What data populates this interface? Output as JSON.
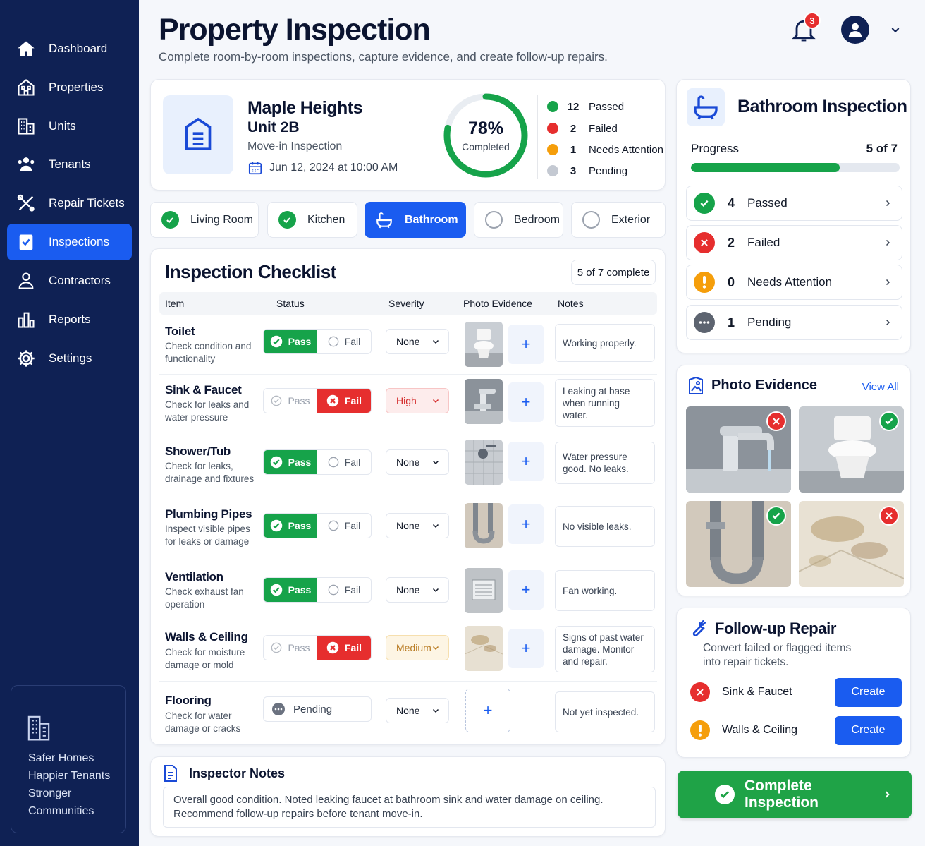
{
  "sidebar": {
    "items": [
      {
        "label": "Dashboard",
        "icon": "home-icon"
      },
      {
        "label": "Properties",
        "icon": "building-icon"
      },
      {
        "label": "Units",
        "icon": "units-icon"
      },
      {
        "label": "Tenants",
        "icon": "tenants-icon"
      },
      {
        "label": "Repair Tickets",
        "icon": "tools-icon"
      },
      {
        "label": "Inspections",
        "icon": "clipboard-check-icon",
        "active": true
      },
      {
        "label": "Contractors",
        "icon": "contractor-icon"
      },
      {
        "label": "Reports",
        "icon": "chart-icon"
      },
      {
        "label": "Settings",
        "icon": "gear-icon"
      }
    ],
    "promo": [
      "Safer Homes",
      "Happier Tenants",
      "Stronger",
      "Communities"
    ]
  },
  "header": {
    "title": "Property Inspection",
    "subtitle": "Complete room-by-room inspections, capture evidence, and create follow-up repairs.",
    "notification_count": "3"
  },
  "property": {
    "name": "Maple Heights",
    "unit": "Unit 2B",
    "type": "Move-in Inspection",
    "date": "Jun 12, 2024 at 10:00 AM",
    "completion_pct": 78,
    "completion_text": "78%",
    "completion_label": "Completed",
    "stats": [
      {
        "count": "12",
        "label": "Passed",
        "color": "#16a34a"
      },
      {
        "count": "2",
        "label": "Failed",
        "color": "#e62e2e"
      },
      {
        "count": "1",
        "label": "Needs Attention",
        "color": "#f59e0b"
      },
      {
        "count": "3",
        "label": "Pending",
        "color": "#c4c9d2"
      }
    ]
  },
  "tabs": [
    {
      "label": "Living Room",
      "state": "done"
    },
    {
      "label": "Kitchen",
      "state": "done"
    },
    {
      "label": "Bathroom",
      "state": "active"
    },
    {
      "label": "Bedroom",
      "state": "todo"
    },
    {
      "label": "Exterior",
      "state": "todo"
    }
  ],
  "checklist": {
    "title": "Inspection Checklist",
    "count": "5 of 7 complete",
    "headers": {
      "item": "Item",
      "status": "Status",
      "severity": "Severity",
      "photo": "Photo Evidence",
      "notes": "Notes"
    },
    "pass_label": "Pass",
    "fail_label": "Fail",
    "pending_label": "Pending",
    "rows": [
      {
        "name": "Toilet",
        "desc": "Check condition and functionality",
        "status": "pass",
        "severity": "None",
        "note": "Working properly."
      },
      {
        "name": "Sink & Faucet",
        "desc": "Check for leaks and water pressure",
        "status": "fail",
        "severity": "High",
        "note": "Leaking at base when running water."
      },
      {
        "name": "Shower/Tub",
        "desc": "Check for leaks, drainage and fixtures",
        "status": "pass",
        "severity": "None",
        "note": "Water pressure good. No leaks."
      },
      {
        "name": "Plumbing Pipes",
        "desc": "Inspect visible pipes for leaks or damage",
        "status": "pass",
        "severity": "None",
        "note": "No visible leaks."
      },
      {
        "name": "Ventilation",
        "desc": "Check exhaust fan operation",
        "status": "pass",
        "severity": "None",
        "note": "Fan working."
      },
      {
        "name": "Walls & Ceiling",
        "desc": "Check for moisture damage or mold",
        "status": "fail",
        "severity": "Medium",
        "note": "Signs of past water damage. Monitor and repair."
      },
      {
        "name": "Flooring",
        "desc": "Check for water damage or cracks",
        "status": "pending",
        "severity": "None",
        "note": "Not yet inspected."
      }
    ]
  },
  "inspector_notes": {
    "title": "Inspector Notes",
    "text": "Overall good condition. Noted leaking faucet at bathroom sink and water damage on ceiling. Recommend follow-up repairs before tenant move-in."
  },
  "bathroom": {
    "title": "Bathroom Inspection",
    "progress_label": "Progress",
    "progress_text": "5 of 7",
    "progress_fraction": 0.714,
    "summary": [
      {
        "count": "4",
        "label": "Passed",
        "kind": "pass"
      },
      {
        "count": "2",
        "label": "Failed",
        "kind": "fail"
      },
      {
        "count": "0",
        "label": "Needs Attention",
        "kind": "warn"
      },
      {
        "count": "1",
        "label": "Pending",
        "kind": "pending"
      }
    ]
  },
  "photo_evidence": {
    "title": "Photo Evidence",
    "view_all": "View All",
    "photos": [
      {
        "subject": "faucet",
        "mark": "fail"
      },
      {
        "subject": "toilet",
        "mark": "pass"
      },
      {
        "subject": "pipes",
        "mark": "pass"
      },
      {
        "subject": "ceiling",
        "mark": "fail"
      }
    ]
  },
  "followup": {
    "title": "Follow-up Repair",
    "subtitle": "Convert failed or flagged items into repair tickets.",
    "create_label": "Create",
    "items": [
      {
        "label": "Sink & Faucet",
        "kind": "fail"
      },
      {
        "label": "Walls & Ceiling",
        "kind": "warn"
      }
    ]
  },
  "complete_button": "Complete Inspection",
  "colors": {
    "brand": "#1a5cf0",
    "sidebar": "#0f2154",
    "pass": "#16a34a",
    "fail": "#e62e2e",
    "warn": "#f59e0b"
  }
}
